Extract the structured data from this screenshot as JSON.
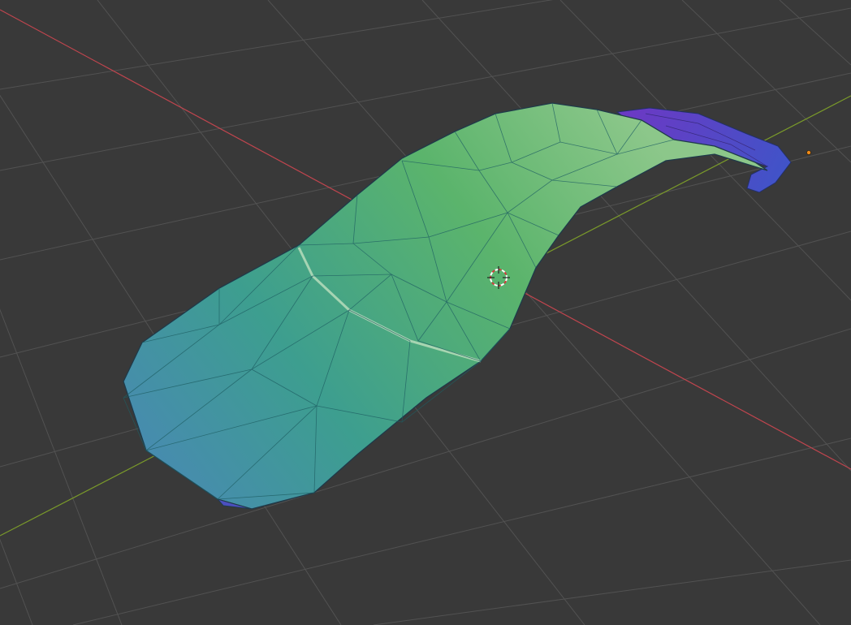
{
  "viewport": {
    "view": "3D Viewport",
    "shading": "vertex-color-wireframe",
    "background_color": "#393939",
    "grid_color": "#525252",
    "x_axis_color": "#c0454e",
    "y_axis_color": "#7a9a2a",
    "mesh_outline_color": "#1f3a4a",
    "mesh_gradient_colors": [
      "#5bb46c",
      "#3d9e8f",
      "#4a86b8",
      "#5a3ccf"
    ],
    "cursor_icon": "3d-cursor-icon",
    "origin_marker_color": "#f08a18"
  }
}
